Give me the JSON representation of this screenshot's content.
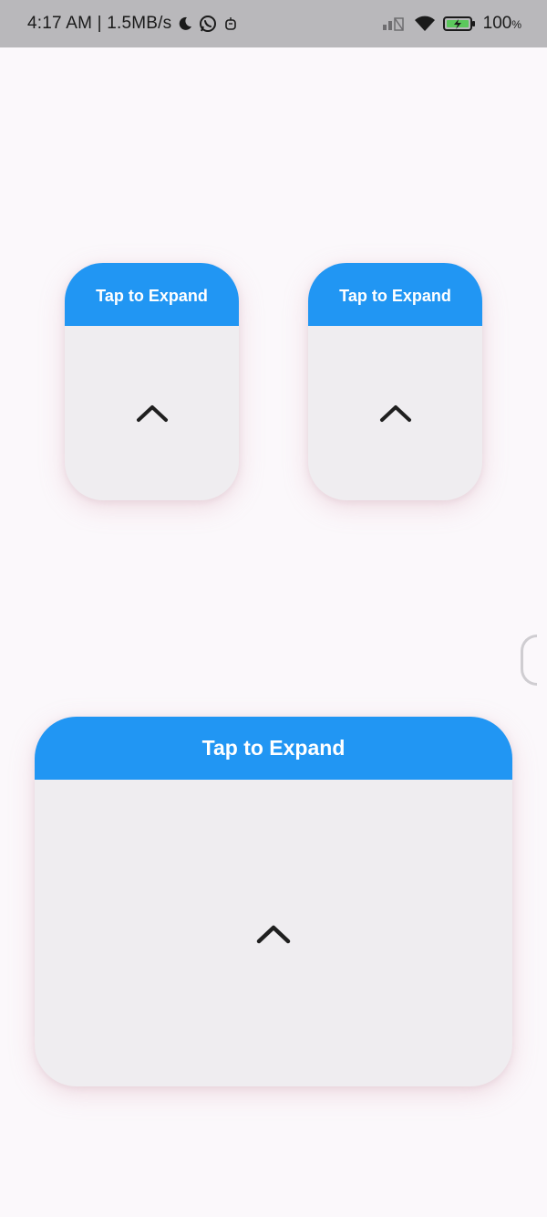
{
  "status_bar": {
    "time_speed": "4:17 AM | 1.5MB/s",
    "battery": "100",
    "battery_unit": "%"
  },
  "cards": [
    {
      "header": "Tap to Expand",
      "icon": "chevron-up-icon"
    },
    {
      "header": "Tap to Expand",
      "icon": "chevron-up-icon"
    },
    {
      "header": "Tap to Expand",
      "icon": "chevron-up-icon"
    }
  ],
  "colors": {
    "header_blue": "#2196f3",
    "card_body": "#efedf0",
    "background": "#fbf8fb",
    "status_bar": "#b9b8bb"
  }
}
